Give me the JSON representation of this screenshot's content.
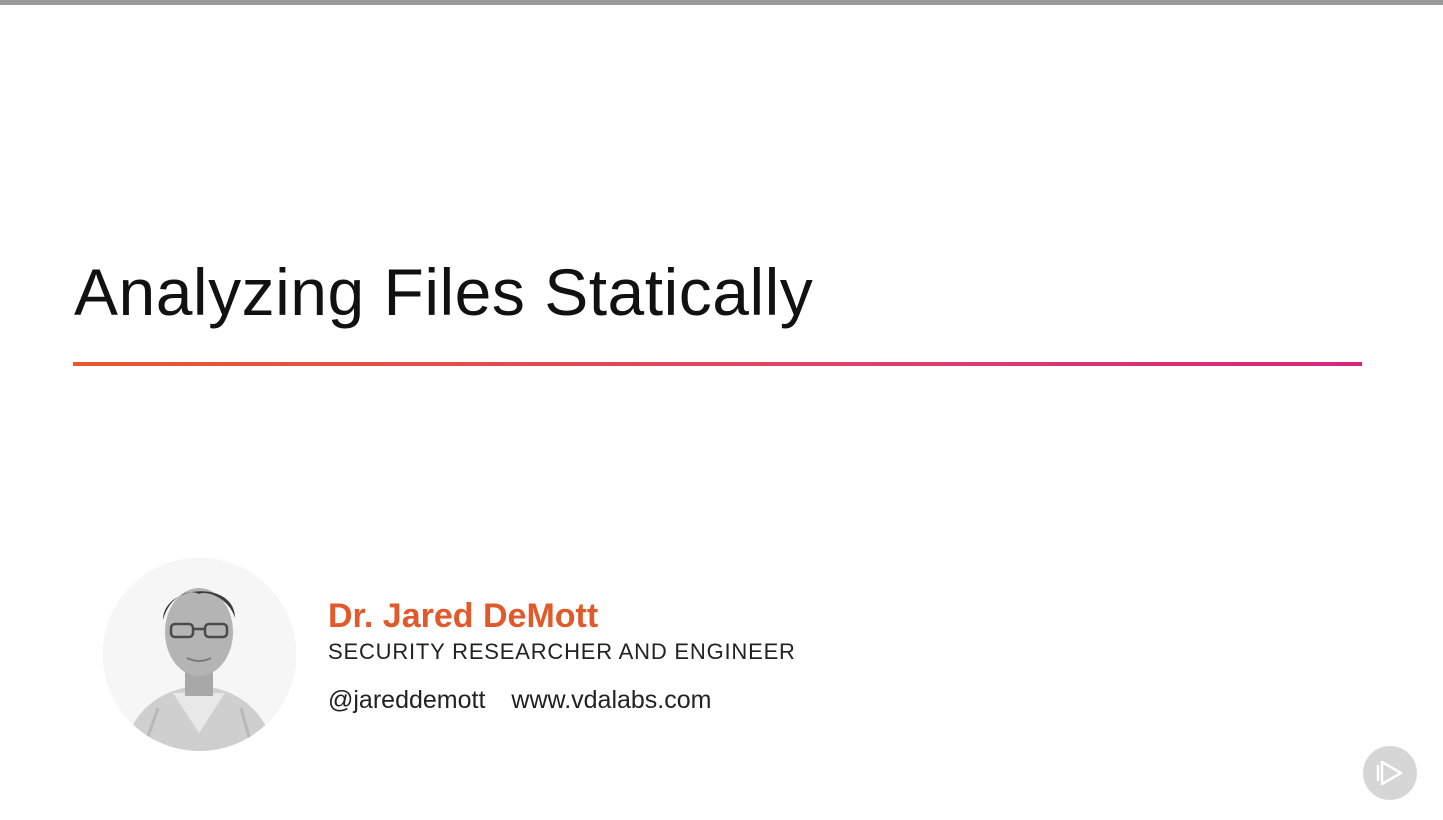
{
  "slide": {
    "title": "Analyzing Files Statically",
    "accent_gradient": [
      "#e8572d",
      "#d9247f"
    ]
  },
  "author": {
    "name": "Dr. Jared DeMott",
    "role": "SECURITY RESEARCHER AND ENGINEER",
    "handle": "@jareddemott",
    "website": "www.vdalabs.com",
    "name_color": "#e05a2b",
    "photo_icon": "author-portrait"
  },
  "player": {
    "play_icon": "play-logo-icon"
  }
}
